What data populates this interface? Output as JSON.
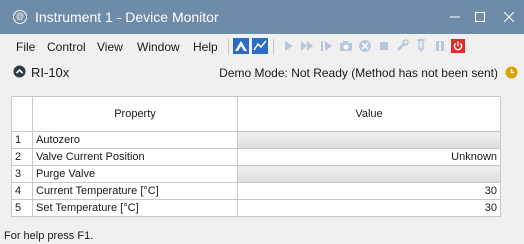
{
  "window": {
    "title": "Instrument 1 - Device Monitor",
    "minimize": "—",
    "maximize": "☐",
    "close": "✕"
  },
  "menu": {
    "file": "File",
    "control": "Control",
    "view": "View",
    "window": "Window",
    "help": "Help"
  },
  "device": {
    "name": "RI-10x",
    "status": "Demo Mode: Not Ready (Method has not been sent)"
  },
  "table": {
    "headers": [
      "Property",
      "Value"
    ],
    "rows": [
      {
        "num": "1",
        "property": "Autozero",
        "value": ""
      },
      {
        "num": "2",
        "property": "Valve Current Position",
        "value": "Unknown"
      },
      {
        "num": "3",
        "property": "Purge Valve",
        "value": ""
      },
      {
        "num": "4",
        "property": "Current Temperature [°C]",
        "value": "30"
      },
      {
        "num": "5",
        "property": "Set Temperature [°C]",
        "value": "30"
      }
    ]
  },
  "status_bar": "For help press F1.",
  "colors": {
    "titlebar": "#6e8baa",
    "accent_blue": "#2b6cc4",
    "stop_red": "#d9302c",
    "warning": "#e0a100"
  }
}
